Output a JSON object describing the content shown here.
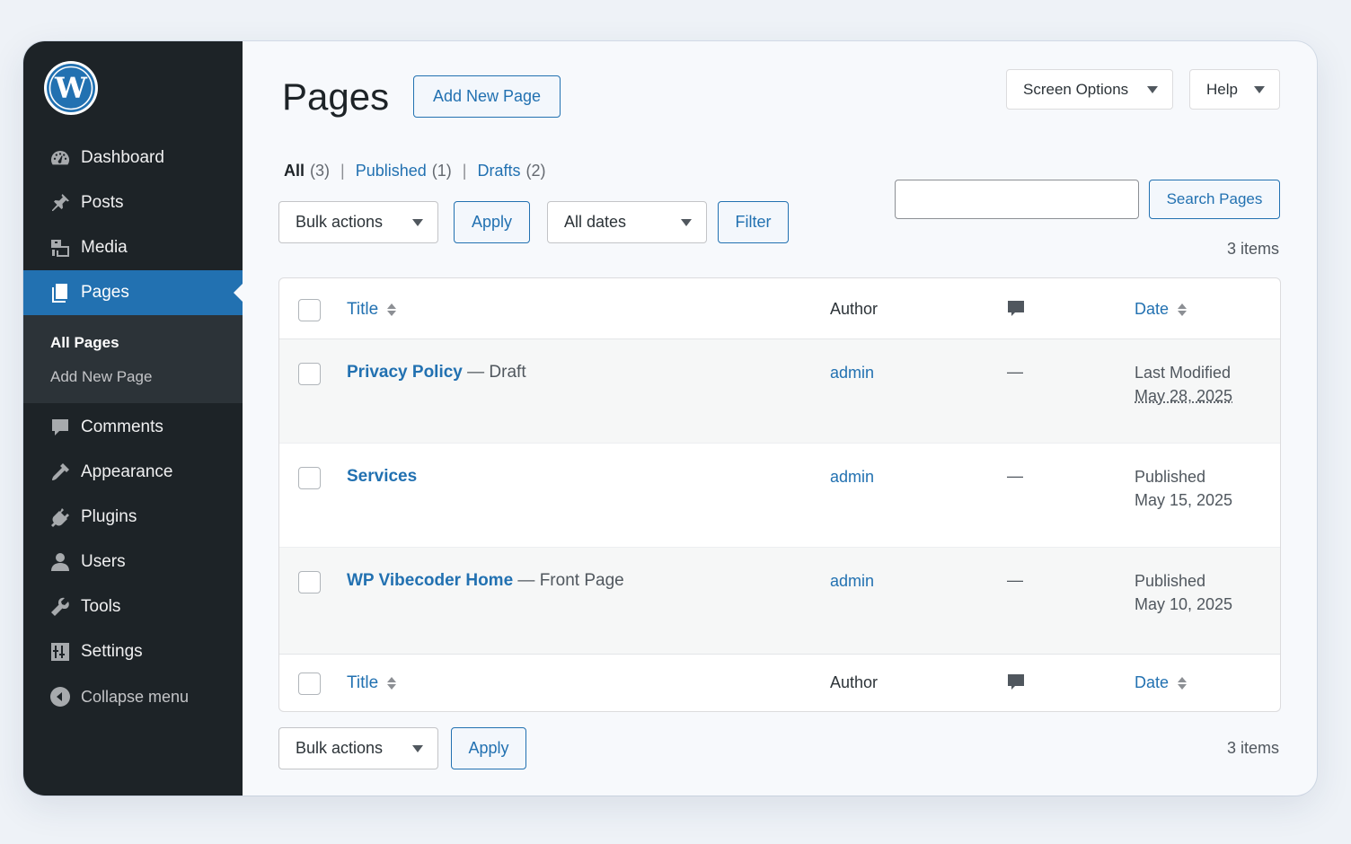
{
  "sidebar": {
    "items": [
      {
        "label": "Dashboard",
        "icon": "dashboard-icon"
      },
      {
        "label": "Posts",
        "icon": "pin-icon"
      },
      {
        "label": "Media",
        "icon": "media-icon"
      },
      {
        "label": "Pages",
        "icon": "pages-icon",
        "active": true
      },
      {
        "label": "Comments",
        "icon": "comment-icon"
      },
      {
        "label": "Appearance",
        "icon": "brush-icon"
      },
      {
        "label": "Plugins",
        "icon": "plug-icon"
      },
      {
        "label": "Users",
        "icon": "user-icon"
      },
      {
        "label": "Tools",
        "icon": "wrench-icon"
      },
      {
        "label": "Settings",
        "icon": "settings-icon"
      }
    ],
    "submenu": [
      "All Pages",
      "Add New Page"
    ],
    "collapse_label": "Collapse menu"
  },
  "header": {
    "title": "Pages",
    "add_new_label": "Add New Page",
    "screen_options_label": "Screen Options",
    "help_label": "Help"
  },
  "views": {
    "all": {
      "label": "All",
      "count": "(3)"
    },
    "published": {
      "label": "Published",
      "count": "(1)"
    },
    "drafts": {
      "label": "Drafts",
      "count": "(2)"
    },
    "separator": "|"
  },
  "filters": {
    "bulk_actions": "Bulk actions",
    "apply": "Apply",
    "dates": "All dates",
    "filter": "Filter",
    "search_value": "",
    "search_button": "Search Pages",
    "items_count": "3 items"
  },
  "table": {
    "columns": {
      "title": "Title",
      "author": "Author",
      "date": "Date"
    },
    "rows": [
      {
        "title": "Privacy Policy",
        "state": "— Draft",
        "author": "admin",
        "comments": "—",
        "status": "Last Modified",
        "date": "May 28, 2025"
      },
      {
        "title": "Services",
        "state": "",
        "author": "admin",
        "comments": "—",
        "status": "Published",
        "date": "May 15, 2025"
      },
      {
        "title": "WP Vibecoder Home",
        "state": "— Front Page",
        "author": "admin",
        "comments": "—",
        "status": "Published",
        "date": "May 10, 2025"
      }
    ]
  },
  "footer": {
    "bulk_actions": "Bulk actions",
    "apply": "Apply",
    "items_count": "3 items"
  },
  "colors": {
    "sidebar_bg": "#1d2327",
    "accent": "#2271b1",
    "page_bg": "#f7f9fc"
  }
}
